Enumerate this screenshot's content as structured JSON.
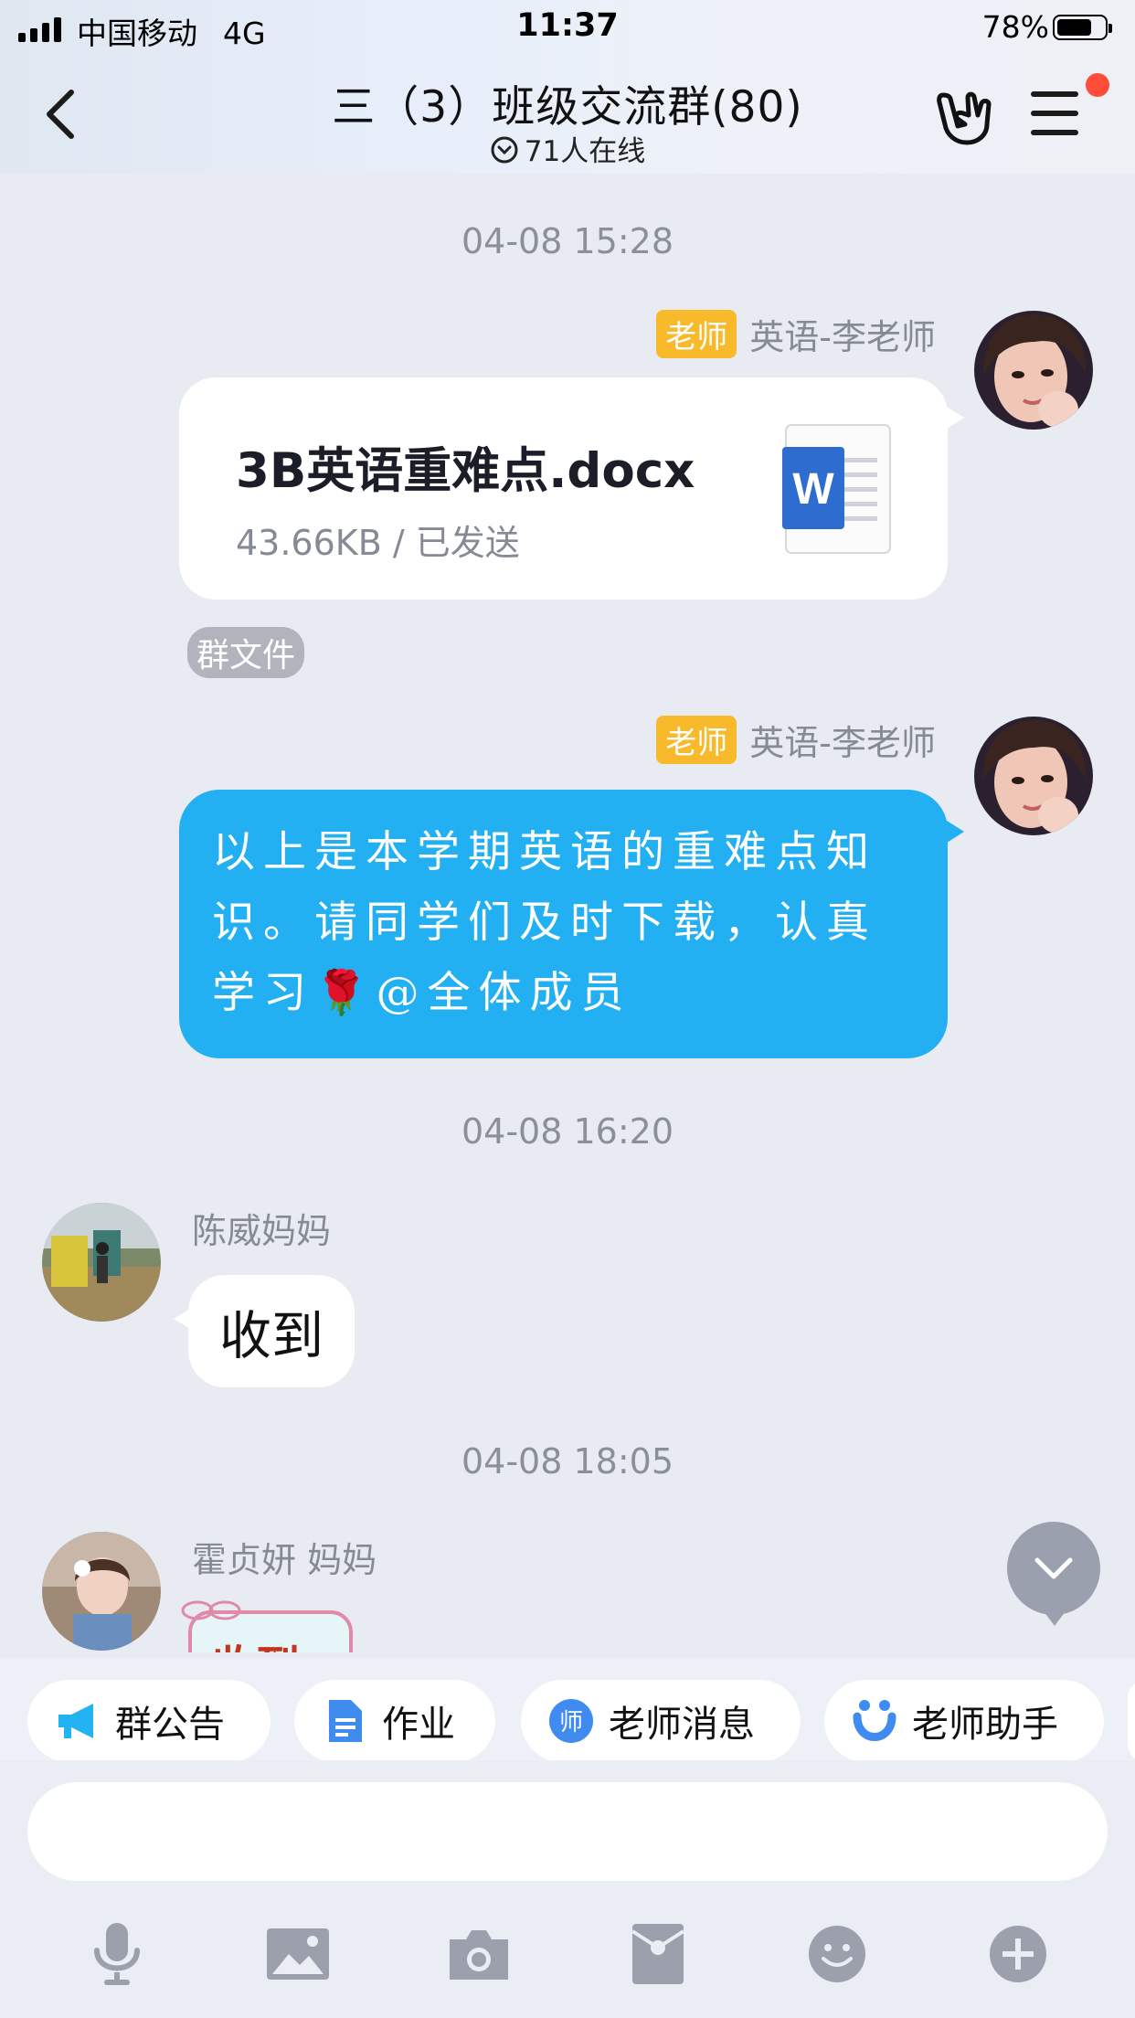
{
  "status_bar": {
    "carrier": "中国移动",
    "network": "4G",
    "time": "11:37",
    "battery_percent": "78%",
    "battery_level": 0.78
  },
  "header": {
    "title": "三（3）班级交流群(80)",
    "online_text": "71人在线",
    "back_icon": "chevron-left-icon",
    "gesture_icon": "rock-hand-icon",
    "menu_icon": "hamburger-menu-icon",
    "menu_badge_color": "#ff4d3a"
  },
  "messages": [
    {
      "timestamp": "04-08 15:28",
      "role_tag": "老师",
      "sender": "英语-李老师",
      "type": "file",
      "file_name": "3B英语重难点.docx",
      "file_meta": "43.66KB / 已发送",
      "file_icon": "word-document-icon",
      "source_tag": "群文件"
    },
    {
      "role_tag": "老师",
      "sender": "英语-李老师",
      "type": "text",
      "text": "以上是本学期英语的重难点知识。请同学们及时下载，认真学习🌹@全体成员",
      "bubble_color": "#22b0f2"
    },
    {
      "timestamp": "04-08 16:20",
      "sender": "陈威妈妈",
      "type": "text",
      "text": "收到"
    },
    {
      "timestamp": "04-08 18:05",
      "sender": "霍贞妍 妈妈",
      "type": "sticker",
      "text": "收到"
    }
  ],
  "quick_bar": [
    {
      "label": "群公告",
      "icon": "megaphone-icon"
    },
    {
      "label": "作业",
      "icon": "document-icon"
    },
    {
      "label": "老师消息",
      "icon": "teacher-badge-icon"
    },
    {
      "label": "老师助手",
      "icon": "assistant-icon"
    }
  ],
  "input": {
    "placeholder": ""
  },
  "toolbar": [
    {
      "name": "voice",
      "icon": "microphone-icon"
    },
    {
      "name": "photo",
      "icon": "image-icon"
    },
    {
      "name": "camera",
      "icon": "camera-icon"
    },
    {
      "name": "red-packet",
      "icon": "red-packet-icon"
    },
    {
      "name": "emoji",
      "icon": "emoji-icon"
    },
    {
      "name": "more",
      "icon": "plus-icon"
    }
  ],
  "colors": {
    "teacher_tag": "#f8b92a",
    "chat_background": "#e8ebf2",
    "toolbar_icon": "#9ca0ad"
  }
}
